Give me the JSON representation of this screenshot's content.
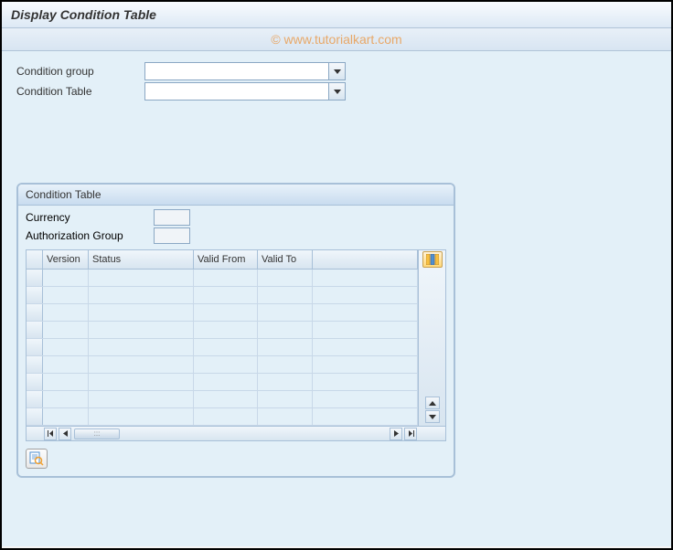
{
  "title": "Display Condition Table",
  "watermark": "© www.tutorialkart.com",
  "fields": {
    "condition_group": {
      "label": "Condition group",
      "value": ""
    },
    "condition_table": {
      "label": "Condition Table",
      "value": ""
    }
  },
  "panel": {
    "title": "Condition Table",
    "currency": {
      "label": "Currency",
      "value": ""
    },
    "auth_group": {
      "label": "Authorization Group",
      "value": ""
    },
    "columns": {
      "version": "Version",
      "status": "Status",
      "valid_from": "Valid From",
      "valid_to": "Valid To"
    },
    "rows": [
      {
        "version": "",
        "status": "",
        "valid_from": "",
        "valid_to": ""
      },
      {
        "version": "",
        "status": "",
        "valid_from": "",
        "valid_to": ""
      },
      {
        "version": "",
        "status": "",
        "valid_from": "",
        "valid_to": ""
      },
      {
        "version": "",
        "status": "",
        "valid_from": "",
        "valid_to": ""
      },
      {
        "version": "",
        "status": "",
        "valid_from": "",
        "valid_to": ""
      },
      {
        "version": "",
        "status": "",
        "valid_from": "",
        "valid_to": ""
      },
      {
        "version": "",
        "status": "",
        "valid_from": "",
        "valid_to": ""
      },
      {
        "version": "",
        "status": "",
        "valid_from": "",
        "valid_to": ""
      },
      {
        "version": "",
        "status": "",
        "valid_from": "",
        "valid_to": ""
      }
    ],
    "hscroll_thumb": ":::"
  },
  "icons": {
    "config": "configurator-icon",
    "details": "details-icon"
  }
}
